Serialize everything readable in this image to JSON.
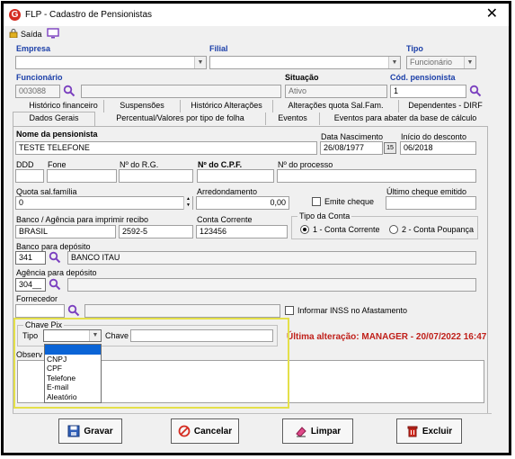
{
  "window": {
    "title": "FLP - Cadastro de Pensionistas",
    "close": "✕"
  },
  "toolbar": {
    "saida": "Saída"
  },
  "header": {
    "empresa_label": "Empresa",
    "filial_label": "Filial",
    "tipo_label": "Tipo",
    "tipo_value": "Funcionário",
    "funcionario_label": "Funcionário",
    "funcionario_value": "003088",
    "situacao_label": "Situação",
    "situacao_value": "Ativo",
    "cod_label": "Cód. pensionista",
    "cod_value": "1"
  },
  "tabs_row1": [
    "Histórico financeiro",
    "Suspensões",
    "Histórico Alterações",
    "Alterações quota Sal.Fam.",
    "Dependentes - DIRF"
  ],
  "tabs_row2": [
    "Dados Gerais",
    "Percentual/Valores por tipo de folha",
    "Eventos",
    "Eventos para abater da base de cálculo"
  ],
  "form": {
    "nome_label": "Nome da pensionista",
    "nome_value": "TESTE TELEFONE",
    "nasc_label": "Data Nascimento",
    "nasc_value": "26/08/1977",
    "cal_label": "15",
    "inicio_label": "Início do desconto",
    "inicio_value": "06/2018",
    "ddd_label": "DDD",
    "fone_label": "Fone",
    "rg_label": "Nº do R.G.",
    "cpf_label": "Nº do C.P.F.",
    "processo_label": "Nº do processo",
    "quota_label": "Quota sal.família",
    "quota_value": "0",
    "arred_label": "Arredondamento",
    "arred_value": "0,00",
    "emite_label": "Emite cheque",
    "ultimo_label": "Último cheque emitido",
    "banco_label": "Banco / Agência para imprimir recibo",
    "banco_value": "BRASIL",
    "agencia_value": "2592-5",
    "conta_label": "Conta Corrente",
    "conta_value": "123456",
    "tipo_conta_label": "Tipo da Conta",
    "tipo_conta_opt1": "1 - Conta Corrente",
    "tipo_conta_opt2": "2 - Conta Poupança",
    "banco_dep_label": "Banco para depósito",
    "banco_dep_code": "341",
    "banco_dep_name": "BANCO ITAU",
    "agencia_dep_label": "Agência para depósito",
    "agencia_dep_value": "304__",
    "fornecedor_label": "Fornecedor",
    "inss_label": "Informar INSS no Afastamento",
    "pix_label": "Chave Pix",
    "pix_tipo_label": "Tipo",
    "pix_chave_label": "Chave",
    "obs_label": "Observ",
    "last_change": "Última alteração: MANAGER - 20/07/2022 16:47"
  },
  "pix_options": [
    "",
    "CNPJ",
    "CPF",
    "Telefone",
    "E-mail",
    "Aleatório"
  ],
  "buttons": {
    "gravar": "Gravar",
    "cancelar": "Cancelar",
    "limpar": "Limpar",
    "excluir": "Excluir"
  },
  "colors": {
    "accent_blue": "#1b3fa8",
    "alert_red": "#c0201a",
    "highlight_yellow": "#e4e04a",
    "select_blue": "#0a64d6"
  }
}
